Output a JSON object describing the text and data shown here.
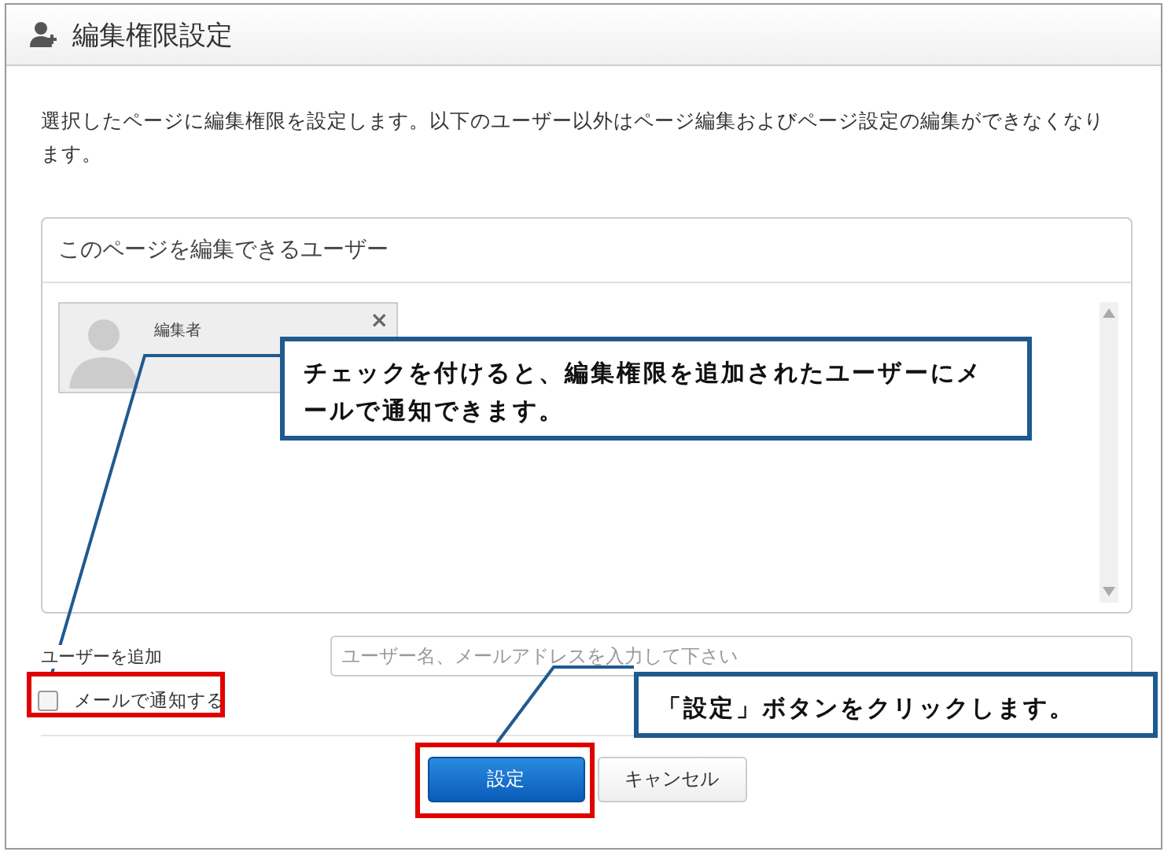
{
  "dialog": {
    "title": "編集権限設定",
    "description": "選択したページに編集権限を設定します。以下のユーザー以外はページ編集およびページ設定の編集ができなくなります。",
    "panel": {
      "title": "このページを編集できるユーザー",
      "users": [
        {
          "name": "編集者",
          "remove": "×"
        }
      ]
    },
    "add_user": {
      "label": "ユーザーを追加",
      "placeholder": "ユーザー名、メールアドレスを入力して下さい"
    },
    "notify": {
      "label": "メールで通知する",
      "checked": false
    },
    "buttons": [
      {
        "label": "設定",
        "kind": "primary"
      },
      {
        "label": "キャンセル",
        "kind": "secondary"
      }
    ]
  },
  "annotations": [
    {
      "text": "チェックを付けると、編集権限を追加されたユーザーにメールで通知できます。"
    },
    {
      "text": "「設定」ボタンをクリックします。"
    }
  ]
}
